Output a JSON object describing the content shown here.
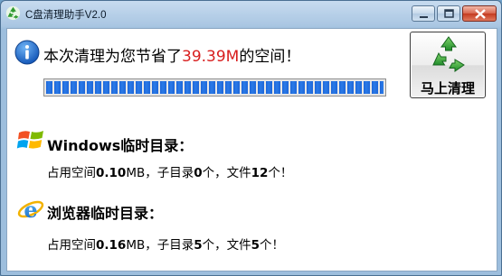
{
  "window": {
    "title": "C盘清理助手V2.0",
    "icons": {
      "app": "recycle-icon",
      "minimize": "minimize-icon",
      "maximize": "maximize-icon",
      "close": "close-icon"
    }
  },
  "summary": {
    "prefix": "本次清理为您节省了",
    "amount": "39.39M",
    "suffix": "的空间！",
    "progress_fraction": 1.0,
    "colors": {
      "amount": "#d81e1e",
      "progress": "#1d66d8"
    }
  },
  "clean_button": {
    "label": "马上清理",
    "icon": "recycle-icon"
  },
  "sections": {
    "windows": {
      "icon": "windows-logo-icon",
      "title": "Windows临时目录：",
      "space_label": "占用空间",
      "space_value": "0.10",
      "space_unit": "MB",
      "subdir_label": "，子目录",
      "subdir_value": "0",
      "subdir_unit": "个",
      "files_label": "，文件",
      "files_value": "12",
      "files_unit": "个！"
    },
    "browser": {
      "icon": "internet-explorer-icon",
      "title": "浏览器临时目录：",
      "space_label": "占用空间",
      "space_value": "0.16",
      "space_unit": "MB",
      "subdir_label": "，子目录",
      "subdir_value": "5",
      "subdir_unit": "个",
      "files_label": "，文件",
      "files_value": "5",
      "files_unit": "个！"
    }
  }
}
